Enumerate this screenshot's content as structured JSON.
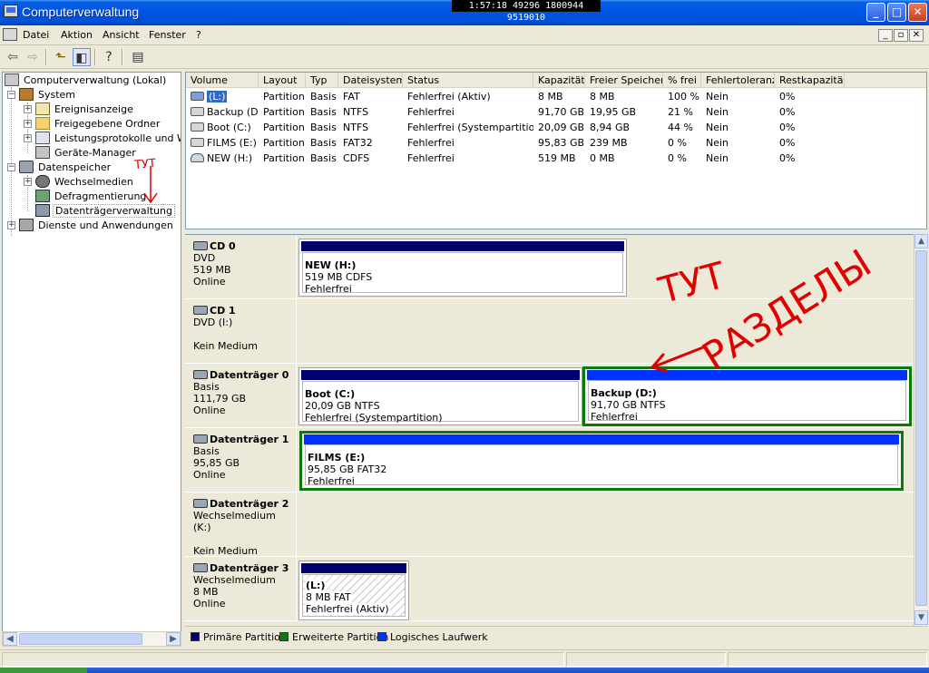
{
  "window": {
    "title": "Computerverwaltung",
    "clock_overlay": "1:57:18 49296 1800944 9519010",
    "minimize_label": "_",
    "maximize_label": "□",
    "close_label": "✕"
  },
  "menu": {
    "items": [
      "Datei",
      "Aktion",
      "Ansicht",
      "Fenster",
      "?"
    ]
  },
  "toolbar": {
    "icons": [
      "back-icon",
      "forward-icon",
      "up-folder-icon",
      "show-tree-icon",
      "help-icon",
      "properties-icon"
    ]
  },
  "tree": {
    "root": "Computerverwaltung (Lokal)",
    "system": "System",
    "event_viewer": "Ereignisanzeige",
    "shared_folders": "Freigegebene Ordner",
    "perf_logs": "Leistungsprotokolle und Warn",
    "device_manager": "Geräte-Manager",
    "storage": "Datenspeicher",
    "removable": "Wechselmedien",
    "defrag": "Defragmentierung",
    "disk_mgmt": "Datenträgerverwaltung",
    "services": "Dienste und Anwendungen"
  },
  "volumes": {
    "columns": [
      "Volume",
      "Layout",
      "Typ",
      "Dateisystem",
      "Status",
      "Kapazität",
      "Freier Speicher",
      "% frei",
      "Fehlertoleranz",
      "Restkapazität"
    ],
    "rows": [
      {
        "volume": "(L:)",
        "layout": "Partition",
        "typ": "Basis",
        "fs": "FAT",
        "status": "Fehlerfrei (Aktiv)",
        "cap": "8 MB",
        "free": "8 MB",
        "pct": "100 %",
        "ft": "Nein",
        "rest": "0%",
        "icon": "removable-volume-icon"
      },
      {
        "volume": "Backup (D:)",
        "layout": "Partition",
        "typ": "Basis",
        "fs": "NTFS",
        "status": "Fehlerfrei",
        "cap": "91,70 GB",
        "free": "19,95 GB",
        "pct": "21 %",
        "ft": "Nein",
        "rest": "0%",
        "icon": "volume-icon"
      },
      {
        "volume": "Boot (C:)",
        "layout": "Partition",
        "typ": "Basis",
        "fs": "NTFS",
        "status": "Fehlerfrei (Systempartition)",
        "cap": "20,09 GB",
        "free": "8,94 GB",
        "pct": "44 %",
        "ft": "Nein",
        "rest": "0%",
        "icon": "volume-icon"
      },
      {
        "volume": "FILMS (E:)",
        "layout": "Partition",
        "typ": "Basis",
        "fs": "FAT32",
        "status": "Fehlerfrei",
        "cap": "95,83 GB",
        "free": "239 MB",
        "pct": "0 %",
        "ft": "Nein",
        "rest": "0%",
        "icon": "volume-icon"
      },
      {
        "volume": "NEW (H:)",
        "layout": "Partition",
        "typ": "Basis",
        "fs": "CDFS",
        "status": "Fehlerfrei",
        "cap": "519 MB",
        "free": "0 MB",
        "pct": "0 %",
        "ft": "Nein",
        "rest": "0%",
        "icon": "cd-volume-icon"
      }
    ]
  },
  "disks": [
    {
      "name": "CD 0",
      "l1": "DVD",
      "l2": "519 MB",
      "l3": "Online",
      "parts": [
        {
          "name": "NEW  (H:)",
          "size": "519 MB CDFS",
          "status": "Fehlerfrei"
        }
      ]
    },
    {
      "name": "CD 1",
      "l1": "DVD (I:)",
      "l2": "",
      "l3": "Kein Medium",
      "parts": []
    },
    {
      "name": "Datenträger 0",
      "l1": "Basis",
      "l2": "111,79 GB",
      "l3": "Online",
      "parts": [
        {
          "name": "Boot  (C:)",
          "size": "20,09 GB NTFS",
          "status": "Fehlerfrei (Systempartition)"
        },
        {
          "name": "Backup  (D:)",
          "size": "91,70 GB NTFS",
          "status": "Fehlerfrei"
        }
      ]
    },
    {
      "name": "Datenträger 1",
      "l1": "Basis",
      "l2": "95,85 GB",
      "l3": "Online",
      "parts": [
        {
          "name": "FILMS  (E:)",
          "size": "95,85 GB FAT32",
          "status": "Fehlerfrei"
        }
      ]
    },
    {
      "name": "Datenträger 2",
      "l1": "Wechselmedium (K:)",
      "l2": "",
      "l3": "Kein Medium",
      "parts": []
    },
    {
      "name": "Datenträger 3",
      "l1": "Wechselmedium",
      "l2": "8 MB",
      "l3": "Online",
      "parts": [
        {
          "name": "(L:)",
          "size": "8 MB FAT",
          "status": "Fehlerfrei (Aktiv)"
        }
      ]
    }
  ],
  "legend": {
    "primary": "Primäre Partition",
    "extended": "Erweiterte Partition",
    "logical": "Logisches Laufwerk",
    "colors": {
      "primary": "#00006e",
      "extended": "#0a7a0a",
      "logical": "#0033ff"
    }
  },
  "annotations": {
    "tree_scribble": "ТУТ",
    "main_scribble_line1": "ТУТ",
    "main_scribble_line2": "РАЗДЕЛЫ",
    "color": "#e00000"
  }
}
